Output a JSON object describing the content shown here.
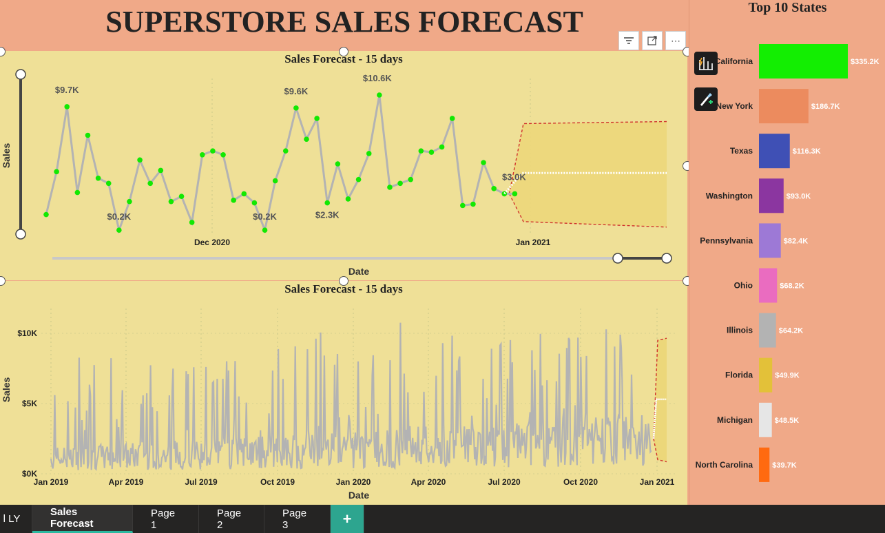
{
  "report_title": "SUPERSTORE SALES FORECAST",
  "visual_toolbar": {
    "filter_icon": "filter-icon",
    "focus_icon": "focus-mode-icon",
    "more_icon": "more-options-icon"
  },
  "side_icons": [
    "chart-analytics-icon",
    "format-brush-icon"
  ],
  "chart_data": [
    {
      "type": "line",
      "title": "Sales Forecast - 15 days",
      "xlabel": "Date",
      "ylabel": "Sales",
      "x_ticks": [
        "Dec 2020",
        "Jan 2021"
      ],
      "series": [
        {
          "values": [
            1.4,
            4.7,
            9.7,
            3.1,
            7.5,
            4.2,
            3.8,
            0.2,
            2.4,
            5.6,
            3.8,
            4.8,
            2.4,
            2.8,
            0.8,
            6.0,
            6.3,
            6.0,
            2.5,
            3.0,
            2.3,
            0.2,
            4.0,
            6.3,
            9.6,
            7.2,
            8.8,
            2.3,
            5.3,
            2.6,
            4.1,
            6.1,
            10.6,
            3.5,
            3.8,
            4.1,
            6.3,
            6.2,
            6.6,
            8.8,
            2.1,
            2.2,
            5.4,
            3.4,
            3.0,
            3.0
          ]
        }
      ],
      "annotations": [
        "$9.7K",
        "$0.2K",
        "$9.6K",
        "$0.2K",
        "$2.3K",
        "$10.6K",
        "$3.0K"
      ],
      "forecast": {
        "value": 4.6,
        "upper": 8.4,
        "lower": 0.7
      }
    },
    {
      "type": "line",
      "title": "Sales Forecast - 15 days",
      "xlabel": "Date",
      "ylabel": "Sales",
      "y_ticks": [
        "$0K",
        "$5K",
        "$10K"
      ],
      "ylim": [
        0,
        10000
      ],
      "x_ticks": [
        "Jan 2019",
        "Apr 2019",
        "Jul 2019",
        "Oct 2019",
        "Jan 2020",
        "Apr 2020",
        "Jul 2020",
        "Oct 2020",
        "Jan 2021"
      ],
      "forecast": {
        "value": 5300,
        "upper": 9500,
        "lower": 1000
      }
    },
    {
      "type": "bar",
      "title": "Top 10 States",
      "categories": [
        "California",
        "New York",
        "Texas",
        "Washington",
        "Pennsylvania",
        "Ohio",
        "Illinois",
        "Florida",
        "Michigan",
        "North Carolina"
      ],
      "values": [
        335.2,
        186.7,
        116.3,
        93.0,
        82.4,
        68.2,
        64.2,
        49.9,
        48.5,
        39.7
      ],
      "labels": [
        "$335.2K",
        "$186.7K",
        "$116.3K",
        "$93.0K",
        "$82.4K",
        "$68.2K",
        "$64.2K",
        "$49.9K",
        "$48.5K",
        "$39.7K"
      ],
      "colors": [
        "#13EE02",
        "#EC8B5E",
        "#3F50B5",
        "#8B36A0",
        "#9D79D6",
        "#EA6CC0",
        "#B3B3B3",
        "#E3C139",
        "#E6E6E6",
        "#FF6A10"
      ]
    }
  ],
  "tabs": [
    {
      "label": "l LY"
    },
    {
      "label": "Sales Forecast",
      "active": true
    },
    {
      "label": "Page 1"
    },
    {
      "label": "Page 2"
    },
    {
      "label": "Page 3"
    },
    {
      "label": "+"
    }
  ]
}
